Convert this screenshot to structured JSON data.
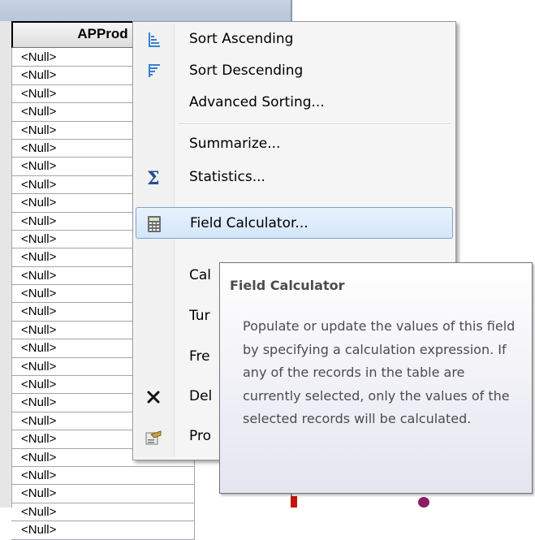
{
  "table": {
    "column_header": "APProd",
    "rows": [
      "<Null>",
      "<Null>",
      "<Null>",
      "<Null>",
      "<Null>",
      "<Null>",
      "<Null>",
      "<Null>",
      "<Null>",
      "<Null>",
      "<Null>",
      "<Null>",
      "<Null>",
      "<Null>",
      "<Null>",
      "<Null>",
      "<Null>",
      "<Null>",
      "<Null>",
      "<Null>",
      "<Null>",
      "<Null>",
      "<Null>",
      "<Null>",
      "<Null>",
      "<Null>",
      "<Null>"
    ]
  },
  "menu": {
    "items": [
      {
        "label": "Sort Ascending",
        "icon": "sort-ascending-icon"
      },
      {
        "label": "Sort Descending",
        "icon": "sort-descending-icon"
      },
      {
        "label": "Advanced Sorting...",
        "icon": ""
      },
      {
        "label": "Summarize...",
        "icon": ""
      },
      {
        "label": "Statistics...",
        "icon": "sigma-icon"
      },
      {
        "label": "Field Calculator...",
        "icon": "calculator-icon",
        "highlighted": true
      },
      {
        "label": "Cal",
        "icon": ""
      },
      {
        "label": "Tur",
        "icon": ""
      },
      {
        "label": "Fre",
        "icon": ""
      },
      {
        "label": "Del",
        "icon": "delete-x-icon"
      },
      {
        "label": "Pro",
        "icon": "properties-icon"
      }
    ]
  },
  "tooltip": {
    "title": "Field Calculator",
    "body": "Populate or update the values of this field by specifying a calculation expression. If any of the records in the table are currently selected, only the values of the selected records will be calculated."
  },
  "colors": {
    "highlight": "#d3e6fa",
    "highlight_border": "#7da2ce",
    "icon_blue": "#3a7fd0",
    "map_point": "#8b1c62"
  }
}
